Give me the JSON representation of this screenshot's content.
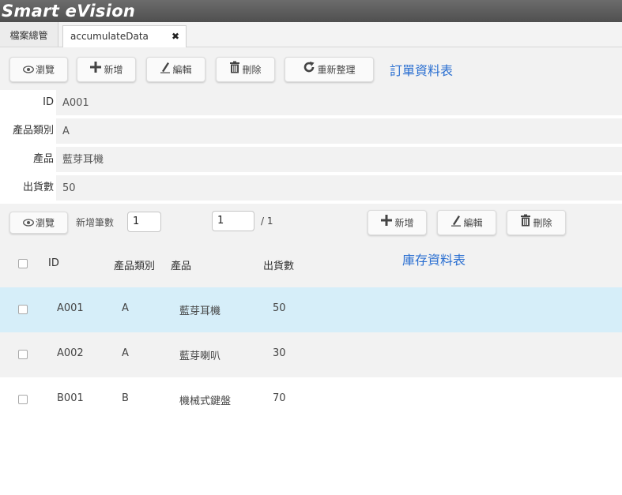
{
  "app": {
    "title": "Smart eVision"
  },
  "tabs": [
    {
      "label": "檔案總管"
    },
    {
      "label": "accumulateData",
      "close": "✖"
    }
  ],
  "toolbar": {
    "view_label": "瀏覽",
    "add_label": "新增",
    "edit_label": "編輯",
    "delete_label": "刪除",
    "refresh_label": "重新整理",
    "section_title": "訂單資料表"
  },
  "form": {
    "fields": [
      {
        "label": "ID",
        "value": "A001"
      },
      {
        "label": "產品類別",
        "value": "A"
      },
      {
        "label": "產品",
        "value": "藍芽耳機"
      },
      {
        "label": "出貨數",
        "value": "50"
      }
    ]
  },
  "detail_toolbar": {
    "view_label": "瀏覽",
    "add_count_label": "新增筆數",
    "add_count_value": "1",
    "page_value": "1",
    "page_total": "/ 1",
    "add_label": "新增",
    "edit_label": "編輯",
    "delete_label": "刪除"
  },
  "grid": {
    "title": "庫存資料表",
    "columns": [
      "ID",
      "產品類別",
      "產品",
      "出貨數"
    ],
    "rows": [
      {
        "id": "A001",
        "category": "A",
        "product": "藍芽耳機",
        "qty": "50",
        "selected": true
      },
      {
        "id": "A002",
        "category": "A",
        "product": "藍芽喇叭",
        "qty": "30",
        "selected": false
      },
      {
        "id": "B001",
        "category": "B",
        "product": "機械式鍵盤",
        "qty": "70",
        "selected": false
      }
    ]
  },
  "colors": {
    "title_bar": "#555555",
    "accent": "#2a6fd1",
    "selected_row": "#d6eef9",
    "panel": "#f2f2f2"
  }
}
